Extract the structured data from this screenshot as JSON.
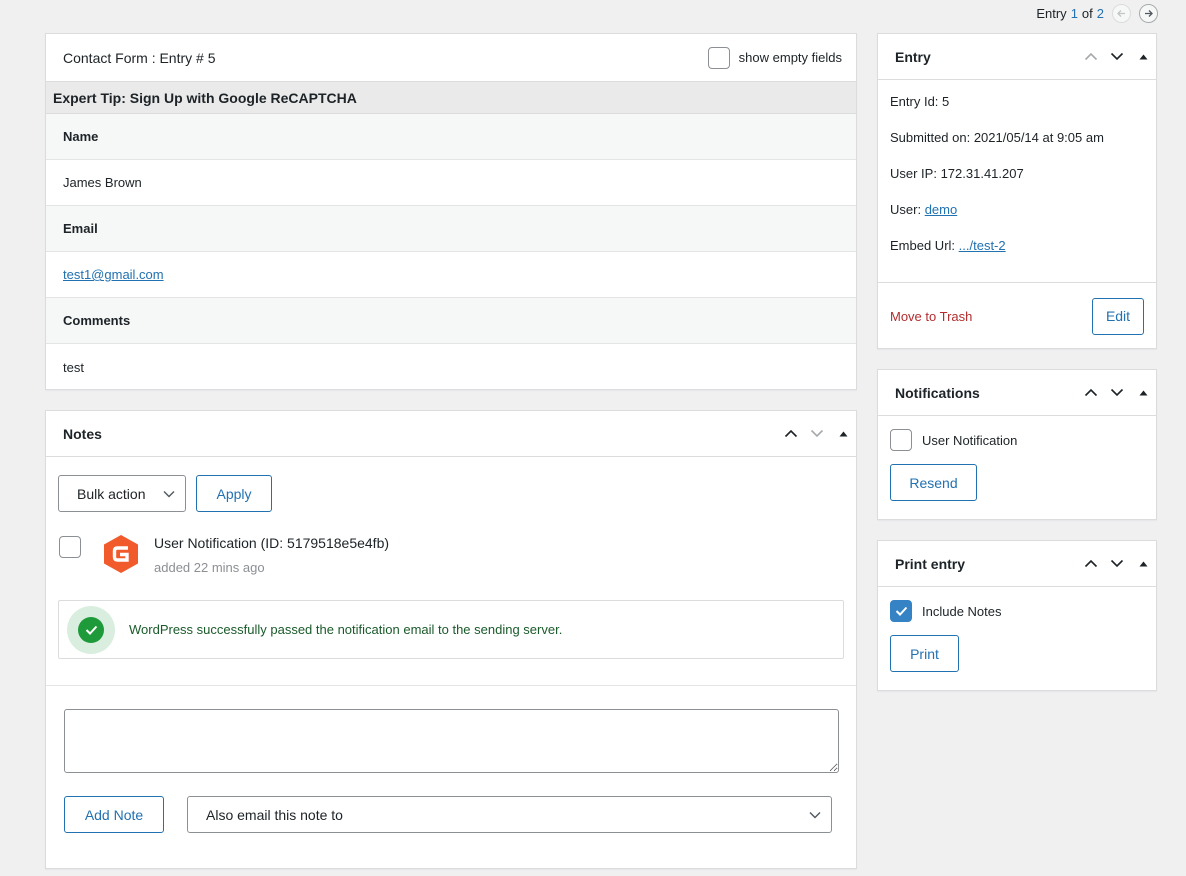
{
  "pager": {
    "prefix": "Entry",
    "current": "1",
    "of": "of",
    "total": "2"
  },
  "detail": {
    "title": "Contact Form : Entry # 5",
    "show_empty_label": "show empty fields",
    "section_title": "Expert Tip: Sign Up with Google ReCAPTCHA",
    "fields": [
      {
        "label": "Name",
        "value": "James Brown"
      },
      {
        "label": "Email",
        "value": "test1@gmail.com"
      },
      {
        "label": "Comments",
        "value": "test"
      }
    ]
  },
  "notes": {
    "title": "Notes",
    "bulk_action": "Bulk action",
    "apply_label": "Apply",
    "note_title": "User Notification (ID: 5179518e5e4fb)",
    "note_time": "added 22 mins ago",
    "success_message": "WordPress successfully passed the notification email to the sending server.",
    "add_note_label": "Add Note",
    "email_select": "Also email this note to"
  },
  "entry": {
    "title": "Entry",
    "entry_id": "Entry Id: 5",
    "submitted": "Submitted on: 2021/05/14 at 9:05 am",
    "user_ip": "User IP: 172.31.41.207",
    "user_label": "User:",
    "user_link": "demo",
    "embed_label": "Embed Url:",
    "embed_link": ".../test-2",
    "trash_label": "Move to Trash",
    "edit_label": "Edit"
  },
  "notifications": {
    "title": "Notifications",
    "option": "User Notification",
    "resend_label": "Resend"
  },
  "print": {
    "title": "Print entry",
    "include_notes": "Include Notes",
    "print_label": "Print"
  },
  "colors": {
    "accent": "#2271b1",
    "danger": "#b32d2e",
    "success": "#1e9a3a",
    "logo": "#f15a2b"
  },
  "icons": [
    "chevron-up-icon",
    "chevron-down-icon",
    "caret-up-icon",
    "arrow-left-icon",
    "arrow-right-icon",
    "check-icon",
    "gravity-forms-logo-icon"
  ]
}
